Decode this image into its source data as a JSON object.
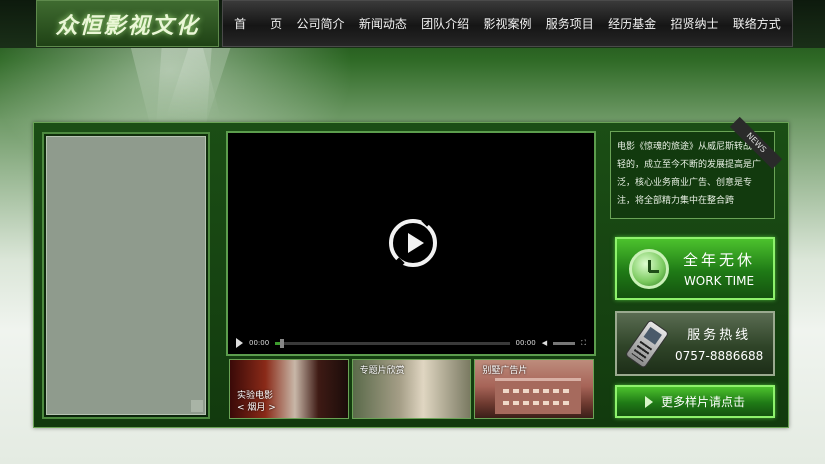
{
  "logo": {
    "text": "众恒影视文化"
  },
  "nav": {
    "items": [
      "首　　页",
      "公司简介",
      "新闻动态",
      "团队介绍",
      "影视案例",
      "服务项目",
      "经历基金",
      "招贤纳士",
      "联络方式"
    ]
  },
  "player": {
    "time_current": "00:00",
    "time_total": "00:00",
    "progress": 0.02
  },
  "thumbs": [
    {
      "line1": "实验电影",
      "line2": "< 烟月 >"
    },
    {
      "line1": "专题片欣赏"
    },
    {
      "line1": "别墅广告片"
    }
  ],
  "news": {
    "ribbon": "NEWS",
    "text": "电影《惊魂的旅途》从威尼斯转战年轻的，成立至今不断的发展提高是广泛，核心业务商业广告、创意是专注，将全部精力集中在整合跨"
  },
  "worktime": {
    "cn": "全年无休",
    "en": "WORK TIME"
  },
  "hotline": {
    "cn": "服务热线",
    "number": "0757-8886688"
  },
  "more": {
    "label": "更多样片请点击"
  },
  "colors": {
    "accent": "#4cc22d",
    "frame": "#1b4e15",
    "border": "#6aa356"
  }
}
